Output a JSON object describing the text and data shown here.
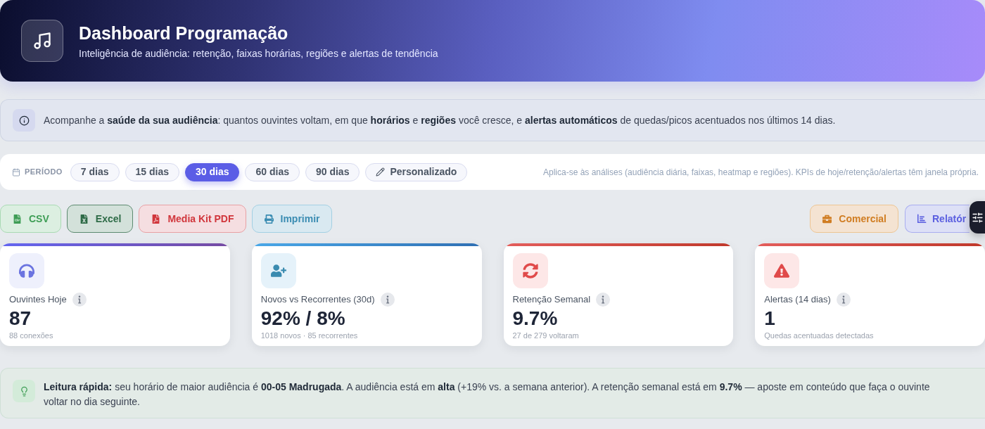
{
  "header": {
    "title": "Dashboard Programação",
    "subtitle": "Inteligência de audiência: retenção, faixas horárias, regiões e alertas de tendência"
  },
  "info_banner": {
    "text": "Acompanhe a **saúde da sua audiência**: quantos ouvintes voltam, em que **horários** e **regiões** você cresce, e **alertas automáticos** de quedas/picos acentuados nos últimos 14 dias."
  },
  "period": {
    "label": "PERÍODO",
    "options": [
      {
        "label": "7 dias",
        "kind": "preset",
        "selected": false
      },
      {
        "label": "15 dias",
        "kind": "preset",
        "selected": false
      },
      {
        "label": "30 dias",
        "kind": "preset",
        "selected": true
      },
      {
        "label": "60 dias",
        "kind": "preset",
        "selected": false
      },
      {
        "label": "90 dias",
        "kind": "preset",
        "selected": false
      },
      {
        "label": "Personalizado",
        "kind": "custom",
        "selected": false
      }
    ],
    "note": "Aplica-se às análises (audiência diária, faixas, heatmap e regiões). KPIs de hoje/retenção/alertas têm janela própria."
  },
  "export_buttons": [
    {
      "label": "CSV",
      "kind": "csv"
    },
    {
      "label": "Excel",
      "kind": "excel"
    },
    {
      "label": "Media Kit PDF",
      "kind": "pdf"
    },
    {
      "label": "Imprimir",
      "kind": "print"
    }
  ],
  "side_buttons": [
    {
      "label": "Comercial",
      "kind": "commercial"
    },
    {
      "label": "Relatór",
      "kind": "report"
    }
  ],
  "kpis": [
    {
      "kind": "listeners",
      "label": "Ouvintes Hoje",
      "value": "87",
      "detail": "88 conexões"
    },
    {
      "kind": "new_vs_returning",
      "label": "Novos vs Recorrentes (30d)",
      "value": "92% / 8%",
      "detail": "1018 novos · 85 recorrentes"
    },
    {
      "kind": "retention",
      "label": "Retenção Semanal",
      "value": "9.7%",
      "detail": "27 de 279 voltaram"
    },
    {
      "kind": "alerts",
      "label": "Alertas (14 dias)",
      "value": "1",
      "detail": "Quedas acentuadas detectadas"
    }
  ],
  "quick_read": {
    "text": "**Leitura rápida:** seu horário de maior audiência é **00-05 Madrugada**. A audiência está em **alta** (+19% vs. a semana anterior). A retenção semanal está em **9.7%** — aposte em conteúdo que faça o ouvinte voltar no dia seguinte."
  }
}
